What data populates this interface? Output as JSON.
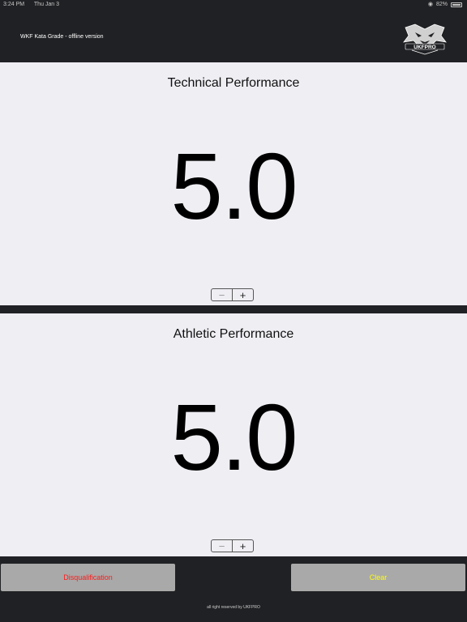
{
  "status_bar": {
    "time": "3:24 PM",
    "date": "Thu Jan 3",
    "battery": "82%",
    "icons": [
      "wifi-icon",
      "battery-icon"
    ]
  },
  "header": {
    "title": "WKF Kata Grade - offline version",
    "logo_text": "UKFPRO"
  },
  "panels": {
    "technical": {
      "title": "Technical Performance",
      "score": "5.0",
      "minus": "−",
      "plus": "+"
    },
    "athletic": {
      "title": "Athletic Performance",
      "score": "5.0",
      "minus": "−",
      "plus": "+"
    }
  },
  "actions": {
    "disqualification": "Disqualification",
    "clear": "Clear"
  },
  "footer": {
    "text": "all right reserved by UKFPRO"
  },
  "colors": {
    "background_dark": "#202124",
    "panel_bg": "#efeef3",
    "button_bg": "#a9a9a9",
    "disqualification_text": "#ff1a1a",
    "clear_text": "#ffff00"
  }
}
